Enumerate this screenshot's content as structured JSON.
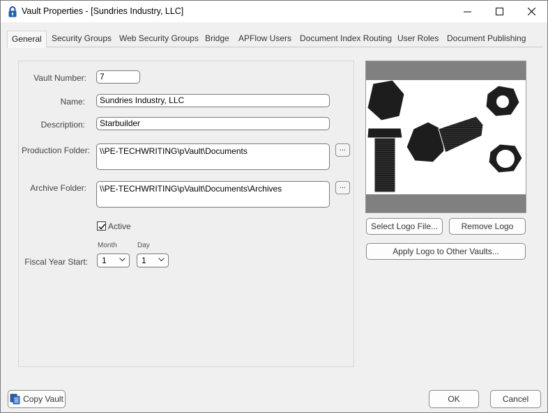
{
  "window": {
    "title": "Vault Properties - [Sundries Industry, LLC]",
    "icon": "lock-icon"
  },
  "tabs": [
    {
      "label": "General",
      "active": true
    },
    {
      "label": "Security Groups"
    },
    {
      "label": "Web Security Groups"
    },
    {
      "label": "Bridge"
    },
    {
      "label": "APFlow Users"
    },
    {
      "label": "Document Index Routing"
    },
    {
      "label": "User Roles"
    },
    {
      "label": "Document Publishing"
    }
  ],
  "general": {
    "vault_number_label": "Vault Number:",
    "vault_number": "7",
    "name_label": "Name:",
    "name": "Sundries Industry, LLC",
    "description_label": "Description:",
    "description": "Starbuilder",
    "production_folder_label": "Production Folder:",
    "production_folder": "\\\\PE-TECHWRITING\\pVault\\Documents",
    "archive_folder_label": "Archive Folder:",
    "archive_folder": "\\\\PE-TECHWRITING\\pVault\\Documents\\Archives",
    "browse_label": "...",
    "active_label": "Active",
    "active_checked": true,
    "fiscal_year_label": "Fiscal Year Start:",
    "month_label": "Month",
    "month_value": "1",
    "day_label": "Day",
    "day_value": "1"
  },
  "logo": {
    "select_label": "Select Logo File...",
    "remove_label": "Remove Logo",
    "apply_label": "Apply Logo to Other Vaults..."
  },
  "footer": {
    "copy_label": "Copy Vault",
    "ok_label": "OK",
    "cancel_label": "Cancel"
  }
}
